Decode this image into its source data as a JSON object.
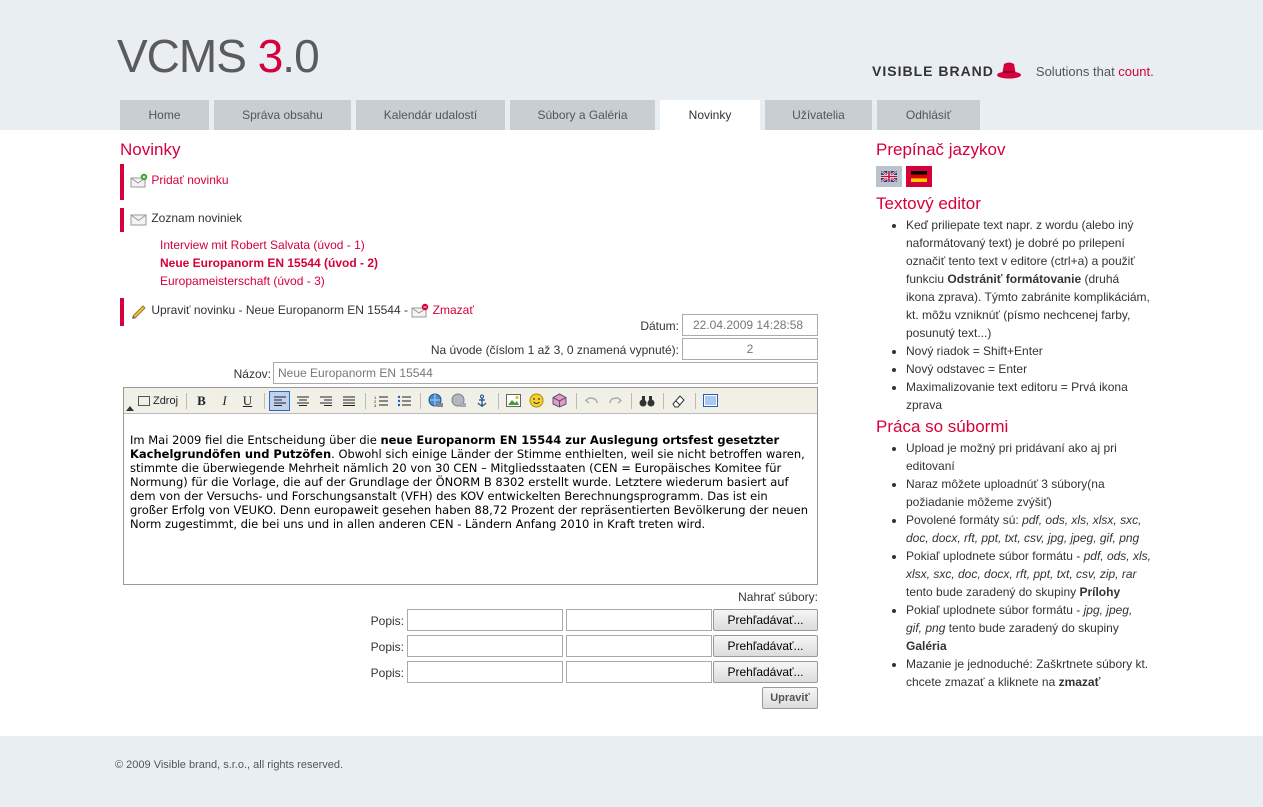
{
  "header": {
    "logo_main": "VCMS ",
    "logo_ver_a": "3",
    "logo_dot": ".",
    "logo_ver_b": "0",
    "brand_name": "VISIBLE BRAND",
    "slogan_a": "Solutions that ",
    "slogan_b": "count."
  },
  "nav": {
    "tabs": [
      {
        "label": "Home"
      },
      {
        "label": "Správa obsahu"
      },
      {
        "label": "Kalendár udalostí"
      },
      {
        "label": "Súbory a Galéria"
      },
      {
        "label": "Novinky",
        "active": true
      },
      {
        "label": "Užívatelia"
      },
      {
        "label": "Odhlásiť"
      }
    ]
  },
  "main": {
    "title": "Novinky",
    "add_news": "Pridať novinku",
    "news_list_label": "Zoznam noviniek",
    "news_items": [
      {
        "label": "Interview mit Robert Salvata (úvod - 1)"
      },
      {
        "label": "Neue Europanorm EN 15544 (úvod - 2)",
        "current": true
      },
      {
        "label": "Europameisterschaft (úvod - 3)"
      }
    ],
    "edit_label": "Upraviť novinku - Neue Europanorm EN 15544 -",
    "delete_label": "Zmazať"
  },
  "form": {
    "date_label": "Dátum:",
    "date_value": "22.04.2009 14:28:58",
    "order_label": "Na úvode (číslom 1 až 3, 0 znamená vypnuté):",
    "order_value": "2",
    "name_label": "Názov:",
    "name_value": "Neue Europanorm EN 15544",
    "toolbar_source": "Zdroj",
    "toolbar_bold": "B",
    "toolbar_italic": "I",
    "toolbar_underline": "U",
    "content_p1": "Im Mai 2009 fiel die Entscheidung über die ",
    "content_bold": "neue Europanorm EN 15544 zur Auslegung ortsfest gesetzter Kachelgrundöfen und Putzöfen",
    "content_p2": ". Obwohl sich einige Länder der Stimme enthielten, weil sie nicht betroffen waren, stimmte die überwiegende Mehrheit nämlich 20 von 30 CEN – Mitgliedsstaaten (CEN = Europäisches Komitee für Normung) für die Vorlage, die auf der Grundlage der ÖNORM B 8302 erstellt wurde. Letztere wiederum basiert auf dem von der Versuchs- und Forschungsanstalt (VFH) des KOV entwickelten Berechnungsprogramm. Das ist ein großer Erfolg von VEUKO. Denn europaweit gesehen haben 88,72 Prozent der repräsentierten Bevölkerung der neuen Norm zugestimmt, die bei uns und in allen anderen CEN - Ländern Anfang 2010 in Kraft treten wird.",
    "upload_label": "Nahrať súbory:",
    "desc_label": "Popis:",
    "browse_label": "Prehľadávať...",
    "submit_label": "Upraviť"
  },
  "sidebar": {
    "lang_title": "Prepínač jazykov",
    "editor_title": "Textový editor",
    "editor_tips": [
      {
        "html": "Keď priliepate text napr. z wordu (alebo iný naformátovaný text) je dobré po prilepení označiť tento text v editore (ctrl+a) a použiť funkciu <b>Odstrániť formátovanie</b> (druhá ikona zprava). Týmto zabránite komplikáciám, kt. môžu vzniknúť (písmo nechcenej farby, posunutý text...)"
      },
      {
        "html": "Nový riadok = Shift+Enter"
      },
      {
        "html": "Nový odstavec = Enter"
      },
      {
        "html": "Maximalizovanie text editoru = Prvá ikona zprava"
      }
    ],
    "files_title": "Práca so súbormi",
    "file_tips": [
      {
        "html": "Upload je možný pri pridávaní ako aj pri editovaní"
      },
      {
        "html": "Naraz môžete uploadnúť 3 súbory(na požiadanie môžeme zvýšiť)"
      },
      {
        "html": "Povolené formáty sú: <i>pdf, ods, xls, xlsx, sxc, doc, docx, rft, ppt, txt, csv, jpg, jpeg, gif, png</i>"
      },
      {
        "html": "Pokiaľ uplodnete súbor formátu - <i>pdf, ods, xls, xlsx, sxc, doc, docx, rft, ppt, txt, csv, zip, rar</i> tento bude zaradený do skupiny <b>Prílohy</b>"
      },
      {
        "html": "Pokiaľ uplodnete súbor formátu - <i>jpg, jpeg, gif, png</i> tento bude zaradený do skupiny <b>Galéria</b>"
      },
      {
        "html": "Mazanie je jednoduché: Zaškrtnete súbory kt. chcete zmazať a kliknete na <b>zmazať</b>"
      }
    ]
  },
  "footer": {
    "copyright": "© 2009 Visible brand, s.r.o., all rights reserved."
  },
  "colors": {
    "accent": "#d6003a",
    "header_bg": "#e9eef2",
    "tab_bg": "#c9ced2"
  }
}
